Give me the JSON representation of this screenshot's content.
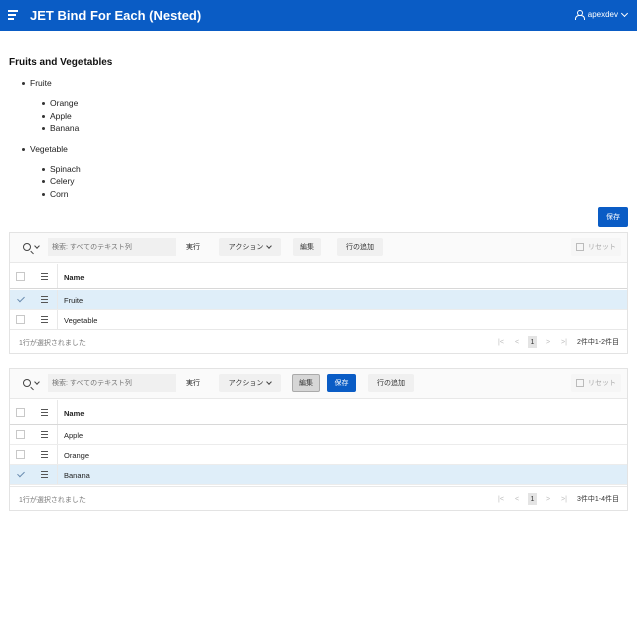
{
  "header": {
    "title": "JET Bind For Each (Nested)",
    "user": "apexdev"
  },
  "region": {
    "title": "Fruits and Vegetables",
    "groups": [
      {
        "label": "Fruite",
        "items": [
          "Orange",
          "Apple",
          "Banana"
        ]
      },
      {
        "label": "Vegetable",
        "items": [
          "Spinach",
          "Celery",
          "Corn"
        ]
      }
    ]
  },
  "save_button": "保存",
  "grid1": {
    "search_placeholder": "検索: すべてのテキスト列",
    "run": "実行",
    "actions": "アクション",
    "edit": "編集",
    "add_row": "行の追加",
    "reset": "リセット",
    "column": "Name",
    "rows": [
      {
        "name": "Fruite",
        "selected": true
      },
      {
        "name": "Vegetable",
        "selected": false
      }
    ],
    "selection_text": "1行が選択されました",
    "page": "1",
    "total": "2件中1-2件目"
  },
  "grid2": {
    "search_placeholder": "検索: すべてのテキスト列",
    "run": "実行",
    "actions": "アクション",
    "edit": "編集",
    "save": "保存",
    "add_row": "行の追加",
    "reset": "リセット",
    "column": "Name",
    "rows": [
      {
        "name": "Apple",
        "selected": false
      },
      {
        "name": "Orange",
        "selected": false
      },
      {
        "name": "Banana",
        "selected": true
      }
    ],
    "selection_text": "1行が選択されました",
    "page": "1",
    "total": "3件中1-4件目"
  },
  "colors": {
    "header_bg": "#0a5cc5",
    "primary": "#0a5cc5",
    "selected_row": "#dfeef9"
  }
}
